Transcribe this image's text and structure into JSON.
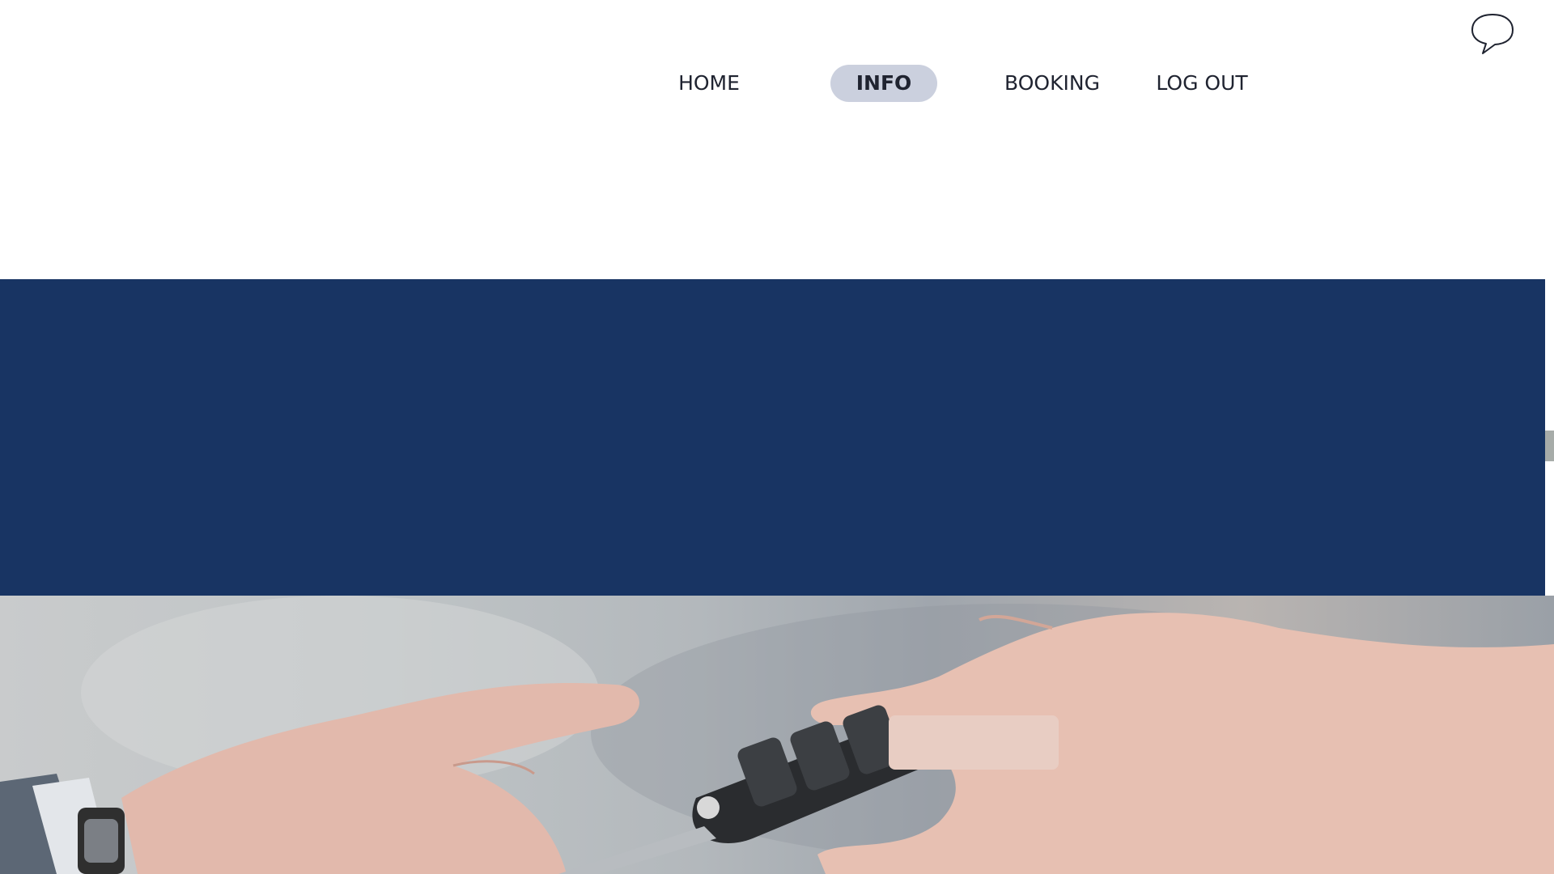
{
  "header": {
    "chat_icon": "speech-bubble-icon"
  },
  "nav": {
    "items": [
      {
        "label": "HOME",
        "active": false
      },
      {
        "label": "INFO",
        "active": true
      },
      {
        "label": "BOOKING",
        "active": false
      },
      {
        "label": "LOG OUT",
        "active": false
      }
    ]
  },
  "hero": {
    "band_color": "#183463",
    "image": "hand-passing-car-key-photo"
  },
  "cta": {
    "label": "",
    "color": "#e8cdc3"
  },
  "colors": {
    "nav_active_bg": "#cbd0de",
    "nav_text": "#1f2330",
    "band": "#183463"
  }
}
